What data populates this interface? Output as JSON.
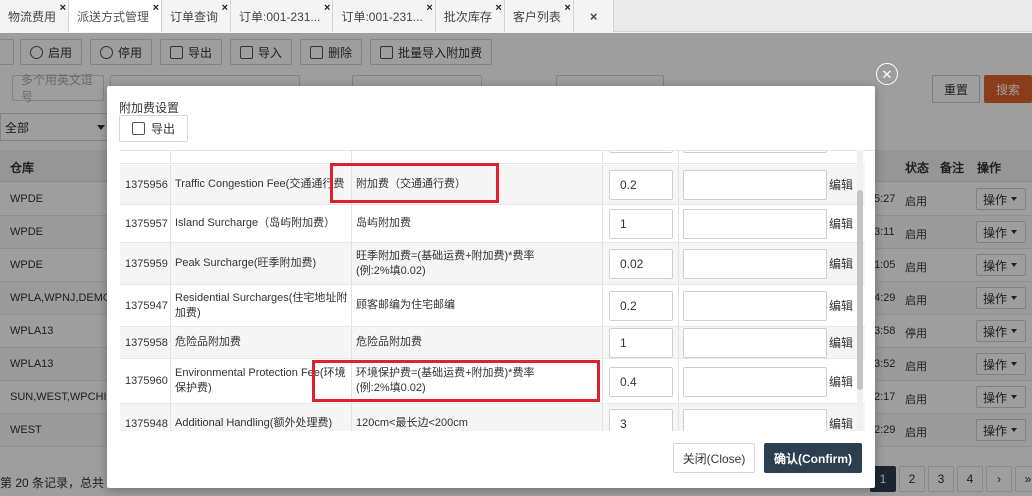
{
  "tabs": [
    {
      "label": "物流费用",
      "active": false
    },
    {
      "label": "派送方式管理",
      "active": true
    },
    {
      "label": "订单查询",
      "active": false
    },
    {
      "label": "订单:001-231...",
      "active": false
    },
    {
      "label": "订单:001-231...",
      "active": false
    },
    {
      "label": "批次库存",
      "active": false
    },
    {
      "label": "客户列表",
      "active": false
    }
  ],
  "tab_close": "×",
  "close_all": "×",
  "toolbar": {
    "enable": "启用",
    "disable": "停用",
    "export": "导出",
    "import": "导入",
    "delete": "删除",
    "batch_import": "批量导入附加费"
  },
  "filters": {
    "placeholder": "多个用英文逗号",
    "all_label": "全部",
    "reset": "重置",
    "search": "搜索"
  },
  "grid": {
    "headers": {
      "warehouse": "仓库",
      "status": "状态",
      "remark": "备注",
      "action": "操作"
    },
    "rows": [
      {
        "warehouse": "WPDE",
        "time": "5:27",
        "status": "启用",
        "action": "操作"
      },
      {
        "warehouse": "WPDE",
        "time": "3:11",
        "status": "启用",
        "action": "操作"
      },
      {
        "warehouse": "WPDE",
        "time": "1:05",
        "status": "启用",
        "action": "操作"
      },
      {
        "warehouse": "WPLA,WPNJ,DEMO...",
        "time": "4:29",
        "status": "启用",
        "action": "操作"
      },
      {
        "warehouse": "WPLA13",
        "time": "3:58",
        "status": "停用",
        "action": "操作"
      },
      {
        "warehouse": "WPLA13",
        "time": "3:52",
        "status": "启用",
        "action": "操作"
      },
      {
        "warehouse": "SUN,WEST,WPCHI...",
        "time": "2:17",
        "status": "启用",
        "action": "操作"
      },
      {
        "warehouse": "WEST",
        "time": "2:29",
        "status": "启用",
        "action": "操作"
      }
    ],
    "footer_text": "第 20 条记录，总共 6",
    "pages": [
      "1",
      "2",
      "3",
      "4",
      "›",
      "»"
    ]
  },
  "modal": {
    "title": "附加费设置",
    "export": "导出",
    "close_btn": "关闭(Close)",
    "confirm_btn": "确认(Confirm)",
    "edit_label": "编辑",
    "rows": [
      {
        "id": "1375956",
        "name": "Traffic Congestion Fee(交通通行费",
        "desc": "附加费（交通通行费）",
        "value": "0.2"
      },
      {
        "id": "1375957",
        "name": "Island Surcharge（岛屿附加费）",
        "desc": "岛屿附加费",
        "value": "1"
      },
      {
        "id": "1375959",
        "name": "Peak Surcharge(旺季附加费)",
        "desc": "旺季附加费=(基础运费+附加费)*费率(例:2%填0.02)",
        "value": "0.02"
      },
      {
        "id": "1375947",
        "name": "Residential Surcharges(住宅地址附加费)",
        "desc": "顾客邮编为住宅邮编",
        "value": "0.2"
      },
      {
        "id": "1375958",
        "name": "危险品附加费",
        "desc": "危险品附加费",
        "value": "1"
      },
      {
        "id": "1375960",
        "name": "Environmental Protection Fee(环境保护费)",
        "desc": "环境保护费=(基础运费+附加费)*费率(例:2%填0.02)",
        "value": "0.4"
      },
      {
        "id": "1375948",
        "name": "Additional Handling(额外处理费)",
        "desc": "120cm<最长边<200cm",
        "value": "3"
      }
    ]
  }
}
